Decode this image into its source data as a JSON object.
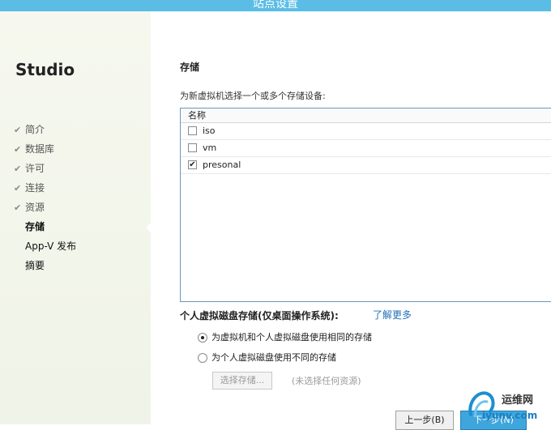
{
  "window": {
    "title": "站点设置"
  },
  "sidebar": {
    "brand": "Studio",
    "items": [
      {
        "label": "简介",
        "state": "done"
      },
      {
        "label": "数据库",
        "state": "done"
      },
      {
        "label": "许可",
        "state": "done"
      },
      {
        "label": "连接",
        "state": "done"
      },
      {
        "label": "资源",
        "state": "done"
      },
      {
        "label": "存储",
        "state": "current"
      },
      {
        "label": "App-V 发布",
        "state": "pending"
      },
      {
        "label": "摘要",
        "state": "pending"
      }
    ]
  },
  "main": {
    "section_title": "存储",
    "instruction": "为新虚拟机选择一个或多个存储设备:",
    "list": {
      "column_header": "名称",
      "rows": [
        {
          "label": "iso",
          "checked": false
        },
        {
          "label": "vm",
          "checked": false
        },
        {
          "label": "presonal",
          "checked": true
        }
      ]
    },
    "disk_storage": {
      "title": "个人虚拟磁盘存储(仅桌面操作系统):",
      "learn_more": "了解更多",
      "options": [
        {
          "label": "为虚拟机和个人虚拟磁盘使用相同的存储",
          "selected": true
        },
        {
          "label": "为个人虚拟磁盘使用不同的存储",
          "selected": false
        }
      ],
      "select_button": "选择存储...",
      "none_selected": "(未选择任何资源)"
    }
  },
  "footer": {
    "back_button": "上一步(B)",
    "next_button": "下一步(N)"
  },
  "watermark": {
    "name": "运维网",
    "url": "iyunv.com"
  },
  "colors": {
    "titlebar": "#5bbde6",
    "accent": "#3ea6dd",
    "link": "#1f6fb8"
  }
}
